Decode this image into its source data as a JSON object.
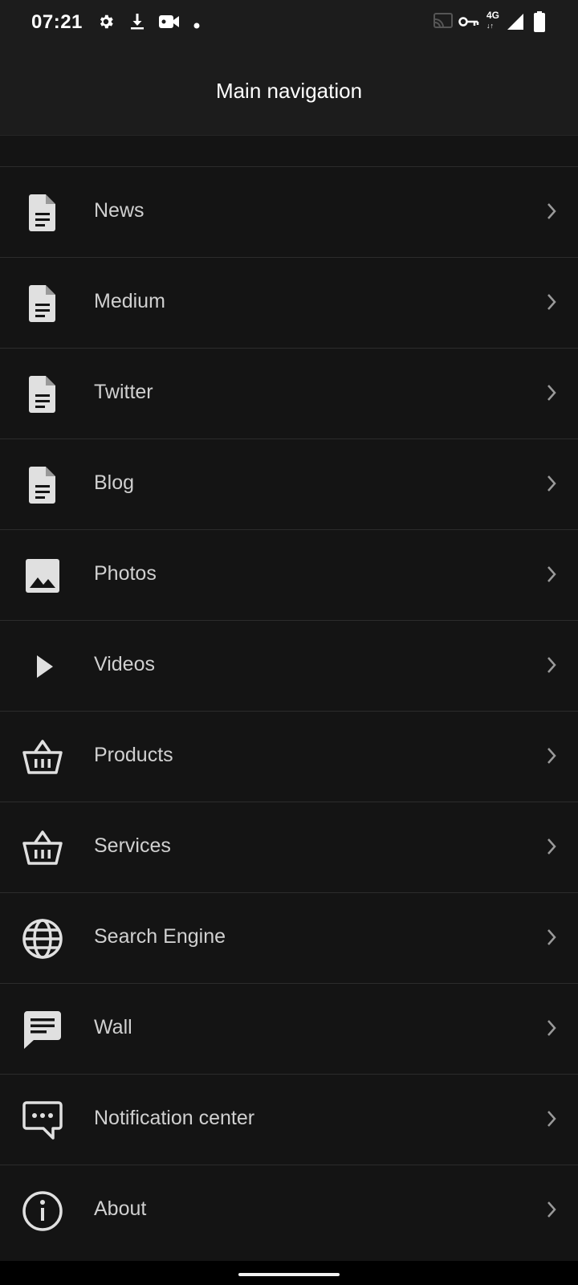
{
  "status_bar": {
    "time": "07:21",
    "network_type": "4G",
    "left_icons": [
      "settings-icon",
      "download-icon",
      "video-camera-icon",
      "dot-icon"
    ],
    "right_icons": [
      "cast-icon",
      "vpn-key-icon",
      "network-4g-icon",
      "signal-icon",
      "battery-icon"
    ]
  },
  "app_bar": {
    "title": "Main navigation"
  },
  "nav": {
    "items": [
      {
        "label": "News",
        "icon": "document-icon"
      },
      {
        "label": "Medium",
        "icon": "document-icon"
      },
      {
        "label": "Twitter",
        "icon": "document-icon"
      },
      {
        "label": "Blog",
        "icon": "document-icon"
      },
      {
        "label": "Photos",
        "icon": "image-icon"
      },
      {
        "label": "Videos",
        "icon": "play-icon"
      },
      {
        "label": "Products",
        "icon": "basket-icon"
      },
      {
        "label": "Services",
        "icon": "basket-icon"
      },
      {
        "label": "Search Engine",
        "icon": "globe-icon"
      },
      {
        "label": "Wall",
        "icon": "message-icon"
      },
      {
        "label": "Notification center",
        "icon": "chat-dots-icon"
      },
      {
        "label": "About",
        "icon": "info-icon"
      }
    ]
  },
  "colors": {
    "background": "#141414",
    "app_bar": "#1c1c1c",
    "label": "#d0d0d0",
    "icon": "#e0e0e0",
    "chevron": "#9a9a9a",
    "divider": "#2c2c2c"
  }
}
